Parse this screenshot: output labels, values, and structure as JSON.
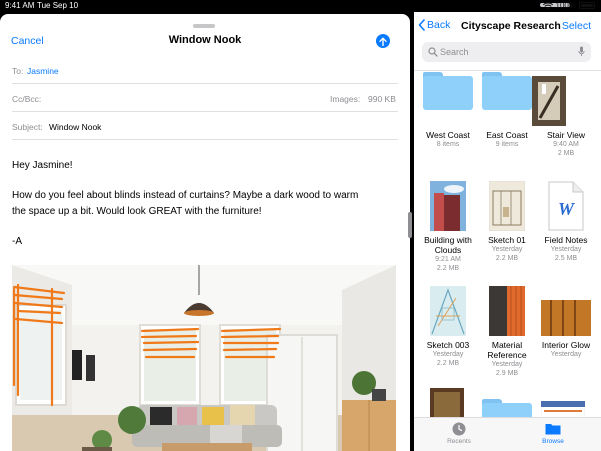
{
  "status_bar": {
    "time": "9:41 AM",
    "date": "Tue Sep 10",
    "battery": "100%"
  },
  "mail": {
    "cancel_label": "Cancel",
    "title": "Window Nook",
    "to_label": "To:",
    "to_value": "Jasmine",
    "ccbcc_label": "Cc/Bcc:",
    "images_label": "Images:",
    "images_size": "990 KB",
    "subject_label": "Subject:",
    "subject_value": "Window Nook",
    "body_greeting": "Hey Jasmine!",
    "body_line1": "How do you feel about blinds instead of curtains? Maybe a dark wood to warm",
    "body_line2": "the space up a bit. Would look GREAT with the furniture!",
    "body_signoff": "-A"
  },
  "files": {
    "back_label": "Back",
    "title": "Cityscape Research",
    "select_label": "Select",
    "search_placeholder": "Search",
    "items": [
      {
        "name": "West Coast",
        "meta1": "8 items",
        "meta2": "",
        "kind": "folder"
      },
      {
        "name": "East Coast",
        "meta1": "9 items",
        "meta2": "",
        "kind": "folder"
      },
      {
        "name": "Stair View",
        "meta1": "9:40 AM",
        "meta2": "2 MB",
        "kind": "image"
      },
      {
        "name": "Building with Clouds",
        "meta1": "9:21 AM",
        "meta2": "2.2 MB",
        "kind": "image"
      },
      {
        "name": "Sketch 01",
        "meta1": "Yesterday",
        "meta2": "2.2 MB",
        "kind": "image"
      },
      {
        "name": "Field Notes",
        "meta1": "Yesterday",
        "meta2": "2.5 MB",
        "kind": "doc"
      },
      {
        "name": "Sketch 003",
        "meta1": "Yesterday",
        "meta2": "2.2 MB",
        "kind": "image"
      },
      {
        "name": "Material Reference",
        "meta1": "Yesterday",
        "meta2": "2.9 MB",
        "kind": "image"
      },
      {
        "name": "Interior Glow",
        "meta1": "Yesterday",
        "meta2": "",
        "kind": "image"
      }
    ],
    "tabs": {
      "recents": "Recents",
      "browse": "Browse"
    }
  },
  "colors": {
    "accent": "#0a7aff",
    "folder": "#8fd0fa",
    "sketch_orange": "#f07a1a"
  }
}
